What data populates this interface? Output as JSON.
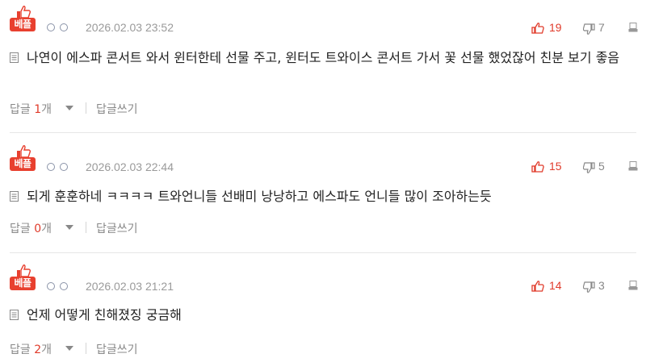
{
  "best_label": "베플",
  "colors": {
    "accent_red": "#e8402f",
    "like_red": "#e03b2b",
    "muted": "#888888"
  },
  "icons": {
    "best": "thumbs-up-icon",
    "like": "thumbs-up-icon",
    "dislike": "thumbs-down-icon",
    "report": "report-icon",
    "document": "document-icon"
  },
  "comments": [
    {
      "date": "2026.02.03 23:52",
      "likes": "19",
      "dislikes": "7",
      "text": "나연이 에스파 콘서트 와서 윈터한테 선물 주고, 윈터도 트와이스 콘서트 가서 꽃 선물 했었잖어 친분 보기 좋음",
      "reply_label": "답글 ",
      "reply_count": "1",
      "reply_unit": "개",
      "write_reply": "답글쓰기"
    },
    {
      "date": "2026.02.03 22:44",
      "likes": "15",
      "dislikes": "5",
      "text": "되게 훈훈하네 ㅋㅋㅋㅋ 트와언니들 선배미 낭낭하고 에스파도 언니들 많이 조아하는듯",
      "reply_label": "답글 ",
      "reply_count": "0",
      "reply_unit": "개",
      "write_reply": "답글쓰기"
    },
    {
      "date": "2026.02.03 21:21",
      "likes": "14",
      "dislikes": "3",
      "text": "언제 어떻게 친해졌징 궁금해",
      "reply_label": "답글 ",
      "reply_count": "2",
      "reply_unit": "개",
      "write_reply": "답글쓰기"
    }
  ]
}
